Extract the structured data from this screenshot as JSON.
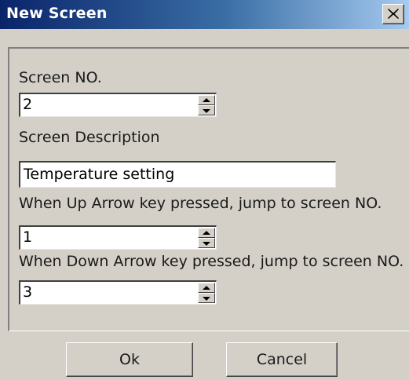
{
  "window": {
    "title": "New Screen",
    "close_icon": "close-icon"
  },
  "form": {
    "screen_no_label": "Screen NO.",
    "screen_no_value": "2",
    "description_label": "Screen Description",
    "description_value": "Temperature setting",
    "up_arrow_label": "When Up Arrow key pressed, jump to screen NO.",
    "up_arrow_value": "1",
    "down_arrow_label": "When Down Arrow key pressed, jump to screen NO.",
    "down_arrow_value": "3"
  },
  "buttons": {
    "ok_label": "Ok",
    "cancel_label": "Cancel"
  },
  "colors": {
    "titlebar_start": "#0a246a",
    "titlebar_end": "#a6caf0",
    "dialog_bg": "#d4d0c8"
  }
}
